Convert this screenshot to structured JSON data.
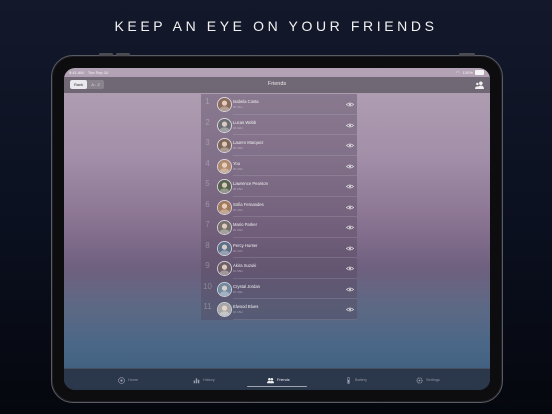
{
  "headline": "KEEP AN EYE ON YOUR FRIENDS",
  "status_bar": {
    "time": "9:41 AM",
    "date": "Tue Sep 10",
    "battery": "100%"
  },
  "nav": {
    "title": "Friends",
    "segments": [
      {
        "label": "Rank",
        "selected": true
      },
      {
        "label": "A - Z",
        "selected": false
      }
    ],
    "right_icon": "add-friend-icon"
  },
  "friends": [
    {
      "rank": "1",
      "name": "Isabela Costa",
      "subtitle": "4h 31m",
      "avatar_color": "#8a6a5a"
    },
    {
      "rank": "2",
      "name": "Lucas Webb",
      "subtitle": "4h 02m",
      "avatar_color": "#6a6d72"
    },
    {
      "rank": "3",
      "name": "Lauren Marquez",
      "subtitle": "3h 48m",
      "avatar_color": "#7d6656"
    },
    {
      "rank": "4",
      "name": "You",
      "subtitle": "3h 20m",
      "avatar_color": "#b08a6c"
    },
    {
      "rank": "5",
      "name": "Lawrence Pearson",
      "subtitle": "3h 05m",
      "avatar_color": "#58634c"
    },
    {
      "rank": "6",
      "name": "Sofia Fernandes",
      "subtitle": "2h 44m",
      "avatar_color": "#a27a5a"
    },
    {
      "rank": "7",
      "name": "Mario Parker",
      "subtitle": "2h 30m",
      "avatar_color": "#75706a"
    },
    {
      "rank": "8",
      "name": "Percy Hunter",
      "subtitle": "2h 12m",
      "avatar_color": "#5a6f8a"
    },
    {
      "rank": "9",
      "name": "Akira Suzuki",
      "subtitle": "1h 58m",
      "avatar_color": "#6d5f66"
    },
    {
      "rank": "10",
      "name": "Crystal Jordan",
      "subtitle": "1h 40m",
      "avatar_color": "#6f8aa1"
    },
    {
      "rank": "11",
      "name": "Elwood Blues",
      "subtitle": "1h 15m",
      "avatar_color": "#a6a6a6"
    }
  ],
  "tabs": [
    {
      "label": "Home",
      "icon": "home-icon",
      "active": false
    },
    {
      "label": "History",
      "icon": "history-icon",
      "active": false
    },
    {
      "label": "Friends",
      "icon": "friends-icon",
      "active": true
    },
    {
      "label": "Battery",
      "icon": "battery-icon",
      "active": false
    },
    {
      "label": "Settings",
      "icon": "settings-icon",
      "active": false
    }
  ],
  "colors": {
    "active_tab": "#f0f0f0",
    "inactive_tab": "#8a8fa0",
    "panel": "#55485f"
  }
}
